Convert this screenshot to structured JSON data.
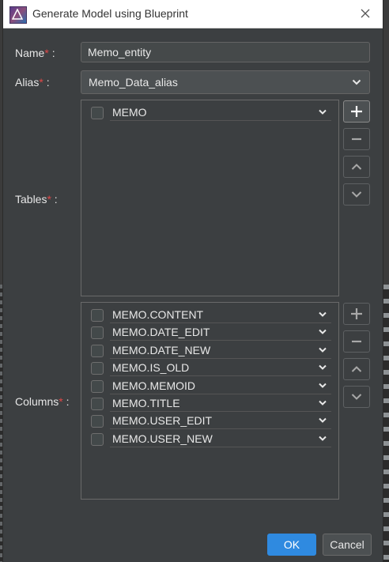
{
  "window": {
    "title": "Generate Model using Blueprint"
  },
  "form": {
    "name": {
      "label": "Name",
      "required_mark": "*",
      "colon": " :",
      "value": "Memo_entity"
    },
    "alias": {
      "label": "Alias",
      "required_mark": "*",
      "colon": " :",
      "selected": "Memo_Data_alias"
    },
    "tables": {
      "label": "Tables",
      "required_mark": "*",
      "colon": " :",
      "items": [
        {
          "value": "MEMO",
          "checked": false
        }
      ]
    },
    "columns": {
      "label": "Columns",
      "required_mark": "*",
      "colon": " :",
      "items": [
        {
          "value": "MEMO.CONTENT",
          "checked": false
        },
        {
          "value": "MEMO.DATE_EDIT",
          "checked": false
        },
        {
          "value": "MEMO.DATE_NEW",
          "checked": false
        },
        {
          "value": "MEMO.IS_OLD",
          "checked": false
        },
        {
          "value": "MEMO.MEMOID",
          "checked": false
        },
        {
          "value": "MEMO.TITLE",
          "checked": false
        },
        {
          "value": "MEMO.USER_EDIT",
          "checked": false
        },
        {
          "value": "MEMO.USER_NEW",
          "checked": false
        }
      ]
    }
  },
  "buttons": {
    "ok": "OK",
    "cancel": "Cancel"
  },
  "colors": {
    "accent": "#2f8ae0",
    "required": "#e04848",
    "panel": "#3c3f41"
  },
  "icons": [
    "app-icon",
    "close-icon",
    "plus-icon",
    "minus-icon",
    "chevron-up-icon",
    "chevron-down-icon"
  ]
}
